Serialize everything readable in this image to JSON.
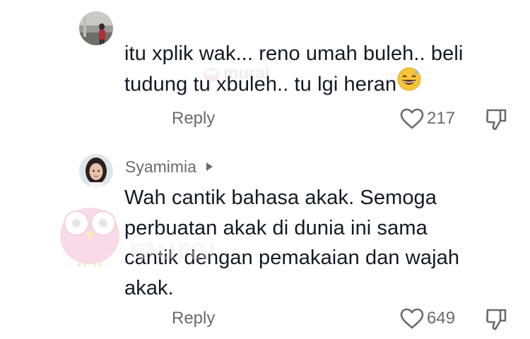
{
  "comments": [
    {
      "username": "",
      "text_line1": "itu xplik wak... reno umah buleh.. beli",
      "text_line2": "tudung tu xbuleh.. tu lgi heran",
      "emoji": "sweat-smile-emoji",
      "reply_label": "Reply",
      "likes": "217"
    },
    {
      "username": "Syamimia",
      "text_lines": [
        "Wah cantik bahasa akak. Semoga",
        "perbuatan akak di dunia ini sama",
        "cantik dengan pemakaian dan wajah",
        "akak."
      ],
      "reply_label": "Reply",
      "likes": "649"
    }
  ],
  "watermark": {
    "small_text": "murai",
    "large_text": "murai"
  },
  "icons": {
    "like": "heart-outline-icon",
    "dislike": "thumbs-down-icon",
    "profile_arrow": "caret-right-icon"
  },
  "colors": {
    "text": "#161823",
    "muted": "#6b6b6b"
  }
}
